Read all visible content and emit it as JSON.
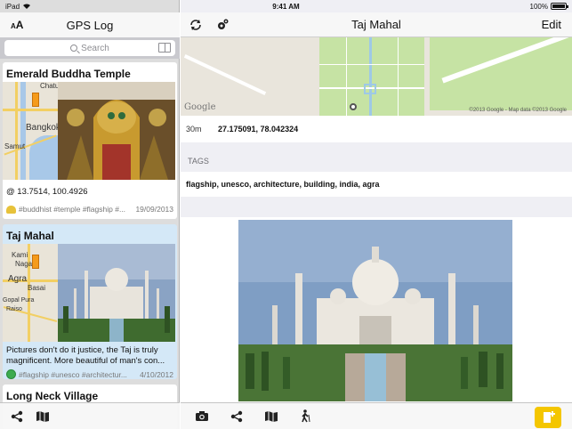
{
  "status_bar": {
    "device": "iPad",
    "time": "9:41 AM",
    "battery": "100%"
  },
  "left_panel": {
    "font_button": {
      "small": "A",
      "large": "A"
    },
    "title": "GPS Log",
    "search": {
      "placeholder": "Search"
    },
    "entries": [
      {
        "title": "Emerald Buddha Temple",
        "map_labels": [
          "Chatu",
          "Bangkok",
          "Samut"
        ],
        "body": "@ 13.7514, 100.4926",
        "tags": "#buddhist #temple #flagship #...",
        "date": "19/09/2013"
      },
      {
        "title": "Taj Mahal",
        "map_labels": [
          "Kami",
          "Naga",
          "Agra",
          "Basai",
          "Gopal Pura",
          "Raiso"
        ],
        "body": "Pictures don't do it justice, the Taj is truly magnificent. More beautiful of man's con...",
        "tags": "#flagship #unesco #architectur...",
        "date": "4/10/2012",
        "selected": true
      },
      {
        "title": "Long Neck Village"
      }
    ],
    "toolbar_icons": [
      "share-icon",
      "map-icon"
    ]
  },
  "right_panel": {
    "title": "Taj Mahal",
    "edit_label": "Edit",
    "nav_icons": [
      "refresh-icon",
      "settings-icon"
    ],
    "map": {
      "google_label": "Google",
      "credit": "©2013 Google - Map data ©2013 Google"
    },
    "location": {
      "accuracy": "30m",
      "coords": "27.175091, 78.042324"
    },
    "tags_header": "TAGS",
    "tags_value": "flagship, unesco, architecture, building, india, agra",
    "toolbar_icons": [
      "camera-icon",
      "share-icon",
      "map-icon",
      "hiker-icon",
      "add-entry-icon"
    ]
  },
  "colors": {
    "accent_yellow": "#f4c600",
    "selected_row": "#d4e8f7",
    "map_park": "#c6e3a4"
  }
}
